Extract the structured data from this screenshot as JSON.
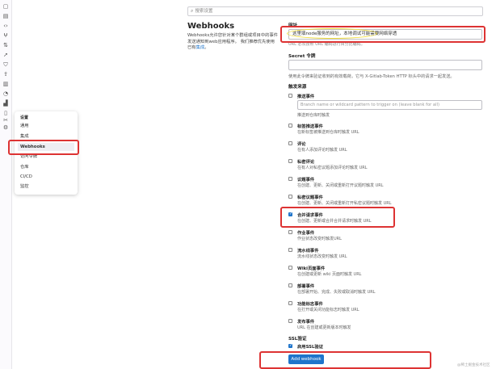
{
  "sidebar_rail": {
    "icons": [
      "issues-icon",
      "doc-icon",
      "code-icon",
      "branch-icon",
      "merge-request-icon",
      "rocket-icon",
      "shield-icon",
      "deploy-icon",
      "server-icon",
      "monitor-icon",
      "cloud-icon",
      "chart-icon",
      "book-icon",
      "snippet-icon",
      "settings-icon"
    ]
  },
  "settings_menu": {
    "header": "设置",
    "items": [
      "通用",
      "集成",
      "Webhooks",
      "访问令牌",
      "仓库",
      "CI/CD",
      "监控"
    ],
    "active": "Webhooks"
  },
  "search": {
    "placeholder": "搜索设置"
  },
  "page": {
    "title": "Webhooks",
    "description": "Webhooks允许您针对某个群组或项目中的事件发送通知到web应用程序。 我们推荐优先使用已有",
    "description_link": "集成",
    "description_end": "。"
  },
  "form": {
    "url_label": "网址",
    "url_value": "这里填node服务的网址，本地调试可能需要网络穿透",
    "url_hint": "URL 必须按照 URL 编码进行百分比编码。",
    "secret_label": "Secret 令牌",
    "secret_help": "使用此令牌来验证收到的有效载荷。它与 X-Gitlab-Token HTTP 标头中的请求一起发送。",
    "trigger_label": "触发来源",
    "branch_placeholder": "Branch name or wildcard pattern to trigger on (leave blank for all)",
    "events": [
      {
        "name": "推送事件",
        "desc": "推送到仓库时触发",
        "checked": false
      },
      {
        "name": "标签推送事件",
        "desc": "在新标签被推送到仓库时触发 URL",
        "checked": false
      },
      {
        "name": "评论",
        "desc": "在有人添加评论时触发 URL",
        "checked": false
      },
      {
        "name": "私密评论",
        "desc": "在有人对私密议题添加评论时触发 URL",
        "checked": false
      },
      {
        "name": "议题事件",
        "desc": "在创建、更新、关闭或重新打开议题时触发 URL",
        "checked": false
      },
      {
        "name": "私密议题事件",
        "desc": "在创建、更新、关闭或重新打开私密议题时触发 URL",
        "checked": false
      },
      {
        "name": "合并请求事件",
        "desc": "在创建、更新或合并合并请求时触发 URL",
        "checked": true
      },
      {
        "name": "作业事件",
        "desc": "作业状态改变时触发URL",
        "checked": false
      },
      {
        "name": "流水线事件",
        "desc": "流水线状态改变时触发 URL",
        "checked": false
      },
      {
        "name": "Wiki页面事件",
        "desc": "在创建或更新 wiki 页面时触发 URL",
        "checked": false
      },
      {
        "name": "部署事件",
        "desc": "在部署开始、完成、失败或取消时触发 URL",
        "checked": false
      },
      {
        "name": "功能标志事件",
        "desc": "在打开或关闭功能标志时触发 URL",
        "checked": false
      },
      {
        "name": "发布事件",
        "desc": "URL 在创建或更新版本时触发",
        "checked": false
      }
    ],
    "ssl_label": "SSL验证",
    "ssl_option": "启用SSL验证",
    "ssl_checked": true,
    "submit_label": "Add webhook"
  },
  "watermark": "@稀土掘金技术社区",
  "colors": {
    "accent": "#1f75cb",
    "highlight_red": "#dd3333",
    "highlight_yellow": "#f1de3a"
  }
}
